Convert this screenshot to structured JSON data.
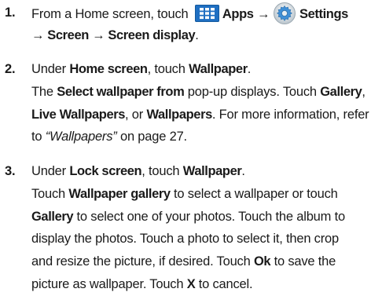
{
  "steps": [
    {
      "number": "1.",
      "lines": [
        {
          "prefix": "From a Home screen, touch ",
          "apps_icon": "apps-grid-icon",
          "apps_label": "Apps",
          "arrow1": "→",
          "settings_icon": "settings-gear-icon",
          "settings_label": "Settings"
        },
        {
          "text": "→ Screen → Screen display",
          "period": "."
        }
      ]
    },
    {
      "number": "2.",
      "l1_a": "Under ",
      "l1_b": "Home screen",
      "l1_c": ", touch ",
      "l1_d": "Wallpaper",
      "l1_e": ".",
      "l2_a": "The ",
      "l2_b": "Select wallpaper from",
      "l2_c": " pop-up displays. Touch ",
      "l2_d": "Gallery",
      "l2_e": ",",
      "l3_a": "Live Wallpapers",
      "l3_b": ", or ",
      "l3_c": "Wallpapers",
      "l3_d": ". For more information, refer",
      "l4_a": "to ",
      "l4_b": "“Wallpapers”",
      "l4_c": "  on page 27."
    },
    {
      "number": "3.",
      "l1_a": "Under ",
      "l1_b": "Lock screen",
      "l1_c": ", touch ",
      "l1_d": "Wallpaper",
      "l1_e": ".",
      "l2_a": "Touch ",
      "l2_b": "Wallpaper gallery",
      "l2_c": " to select a wallpaper or touch",
      "l3_a": "Gallery",
      "l3_b": " to select one of your photos. Touch the album to",
      "l4": "display the photos. Touch a photo to select it, then crop",
      "l5_a": "and resize the picture, if desired. Touch ",
      "l5_b": "Ok",
      "l5_c": " to save the",
      "l6_a": "picture as wallpaper. Touch ",
      "l6_b": "X",
      "l6_c": " to cancel."
    }
  ],
  "colors": {
    "apps_icon_bg": "#1f6fc2",
    "text": "#1a1a1a"
  }
}
